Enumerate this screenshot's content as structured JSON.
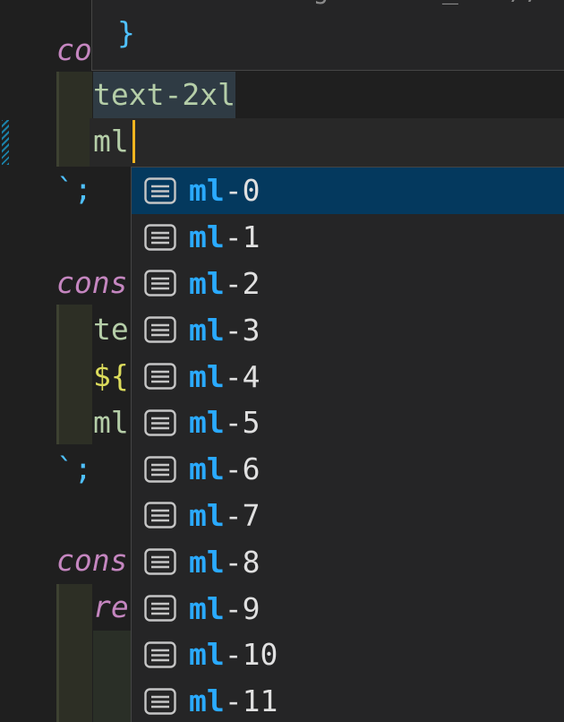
{
  "editor": {
    "lines": {
      "kw_top": "co",
      "hover_brace": "}",
      "hover_partial": ":  o  .g    :  _   ),",
      "prev_class": "text-2xl",
      "typed": "ml",
      "close_1": "`;",
      "kw_2": "cons",
      "frag_te": "te",
      "frag_interp": "${",
      "frag_ml": "ml",
      "close_2": "`;",
      "kw_3": "cons",
      "frag_re": "re"
    }
  },
  "suggest": {
    "match": "ml",
    "icon": "text-snippet-icon",
    "items": [
      {
        "rest": "-0"
      },
      {
        "rest": "-1"
      },
      {
        "rest": "-2"
      },
      {
        "rest": "-3"
      },
      {
        "rest": "-4"
      },
      {
        "rest": "-5"
      },
      {
        "rest": "-6"
      },
      {
        "rest": "-7"
      },
      {
        "rest": "-8"
      },
      {
        "rest": "-9"
      },
      {
        "rest": "-10"
      },
      {
        "rest": "-11"
      }
    ],
    "selected_index": 0
  },
  "colors": {
    "background": "#1f1f1f",
    "selection": "#04395e",
    "match": "#2aaaff",
    "caret": "#f1b51f",
    "keyword": "#c586c0",
    "string": "#b5cea8"
  }
}
